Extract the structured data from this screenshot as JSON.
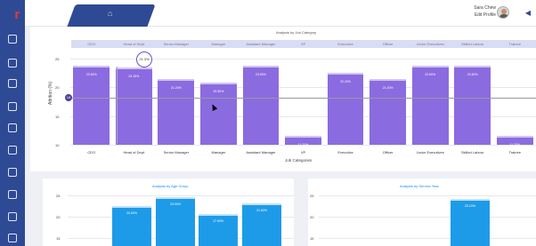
{
  "app": {
    "brand_letters": [
      "m",
      "r"
    ]
  },
  "header": {
    "user_name": "Sara Chew",
    "edit_profile": "Edit Profile"
  },
  "job_chart": {
    "title": "Analysis by Job Category",
    "y_label": "Attrition (%)",
    "x_label": "Job Categories",
    "tooltip": "21.3%",
    "marker_label": "18",
    "y_ticks": [
      "25",
      "20",
      "15",
      "10"
    ],
    "header_labels": [
      "CEO",
      "Head of Dept",
      "Senior Manager",
      "Manager",
      "Assistant Manager",
      "VP",
      "Executive",
      "Officer",
      "Junior Executives",
      "Skilled Labour",
      "Trainee"
    ],
    "chart_data": {
      "type": "bar",
      "categories": [
        "CEO",
        "Head of Dept",
        "Senior Manager",
        "Manager",
        "Assistant Manager",
        "VP",
        "Executive",
        "Officer",
        "Junior Executives",
        "Skilled Labour",
        "Trainee"
      ],
      "values": [
        23.5,
        23.15,
        21.2,
        20.5,
        23.5,
        11.2,
        22.2,
        21.2,
        23.5,
        23.5,
        11.2
      ],
      "labels": [
        "23.50%",
        "23.15%",
        "21.20%",
        "20.50%",
        "23.50%",
        "11.20%",
        "22.20%",
        "21.20%",
        "23.50%",
        "23.50%",
        "11.20%"
      ],
      "ylim": [
        10,
        25
      ]
    }
  },
  "age_chart": {
    "title": "Analysis by Age Group",
    "y_ticks": [
      "25",
      "20",
      "15"
    ],
    "chart_data": {
      "type": "bar",
      "values": [
        20.6,
        23.9,
        17.9,
        21.6
      ],
      "labels": [
        "20.60%",
        "23.90%",
        "17.90%",
        "21.60%"
      ],
      "ylim": [
        10,
        25
      ]
    }
  },
  "service_chart": {
    "title": "Analysis by Service Year",
    "y_ticks": [
      "25",
      "20",
      "15"
    ],
    "chart_data": {
      "type": "bar",
      "values": [
        23.1
      ],
      "labels": [
        "23.10%"
      ],
      "ylim": [
        10,
        25
      ]
    }
  }
}
